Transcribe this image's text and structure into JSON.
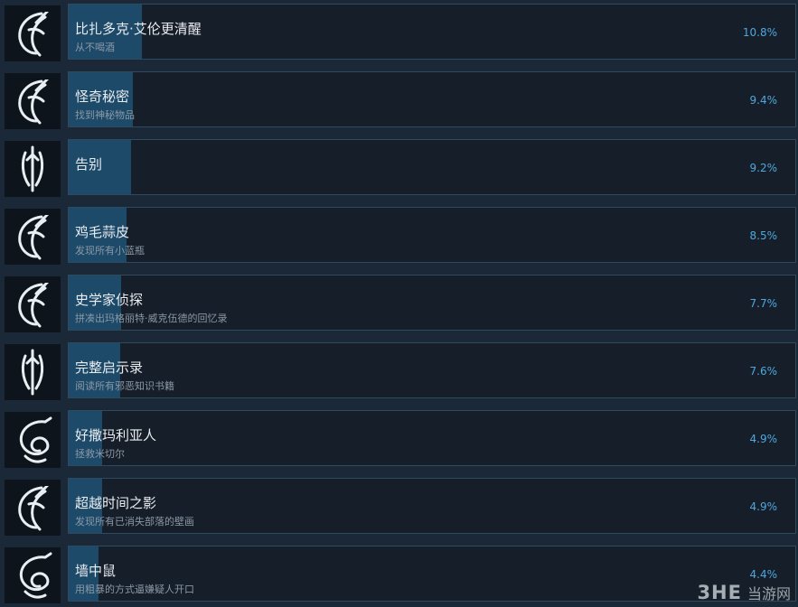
{
  "achievements": [
    {
      "title": "比扎多克·艾伦更清醒",
      "desc": "从不喝酒",
      "percent": "10.8%",
      "fill": 10.8,
      "icon": "claw-sigil-icon"
    },
    {
      "title": "怪奇秘密",
      "desc": "找到神秘物品",
      "percent": "9.4%",
      "fill": 9.4,
      "icon": "claw-sigil-icon"
    },
    {
      "title": "告别",
      "desc": "",
      "percent": "9.2%",
      "fill": 9.2,
      "icon": "spire-sigil-icon"
    },
    {
      "title": "鸡毛蒜皮",
      "desc": "发现所有小蓝瓶",
      "percent": "8.5%",
      "fill": 8.5,
      "icon": "claw-sigil-icon"
    },
    {
      "title": "史学家侦探",
      "desc": "拼凑出玛格丽特·威克伍德的回忆录",
      "percent": "7.7%",
      "fill": 7.7,
      "icon": "claw-sigil-icon"
    },
    {
      "title": "完整启示录",
      "desc": "阅读所有邪恶知识书籍",
      "percent": "7.6%",
      "fill": 7.6,
      "icon": "spire-sigil-icon"
    },
    {
      "title": "好撒玛利亚人",
      "desc": "拯救米切尔",
      "percent": "4.9%",
      "fill": 4.9,
      "icon": "serpent-sigil-icon"
    },
    {
      "title": "超越时间之影",
      "desc": "发现所有已消失部落的壁画",
      "percent": "4.9%",
      "fill": 4.9,
      "icon": "claw-sigil-icon"
    },
    {
      "title": "墙中鼠",
      "desc": "用粗暴的方式逼嫌疑人开口",
      "percent": "4.4%",
      "fill": 4.4,
      "icon": "serpent-sigil-icon"
    }
  ],
  "watermark": {
    "logo": "3HE",
    "text": "当游网"
  },
  "colors": {
    "background": "#1b2838",
    "fill": "#1e4a6a",
    "percent": "#4fa7dd",
    "border": "#2f4a5e"
  }
}
